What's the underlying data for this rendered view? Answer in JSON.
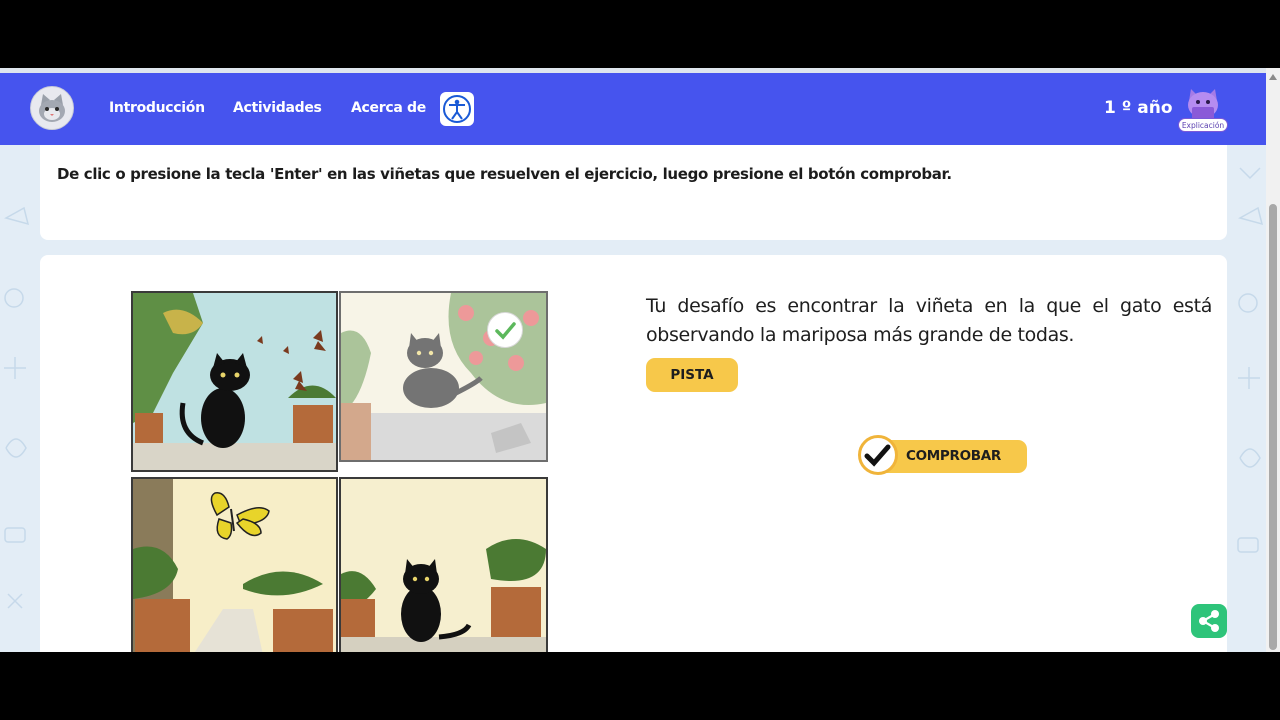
{
  "nav": {
    "links": [
      "Introducción",
      "Actividades",
      "Acerca de"
    ],
    "grade": "1 º año",
    "explanation_label": "Explicación",
    "logo_icon": "cat-avatar-icon",
    "accessibility_icon": "accessibility-icon",
    "color": "#4654ee"
  },
  "instruction": "De clic o presione la tecla 'Enter' en las viñetas que resuelven el ejercicio, luego presione el botón comprobar.",
  "challenge": "Tu desafío es encontrar la viñeta en la que el gato está observando la mariposa más grande de todas.",
  "buttons": {
    "hint": "PISTA",
    "check": "COMPROBAR",
    "accent": "#f7c84a"
  },
  "panels": [
    {
      "id": 1,
      "selected": false
    },
    {
      "id": 2,
      "selected": true
    },
    {
      "id": 3,
      "selected": false
    },
    {
      "id": 4,
      "selected": false
    }
  ],
  "share_icon": "share-icon"
}
